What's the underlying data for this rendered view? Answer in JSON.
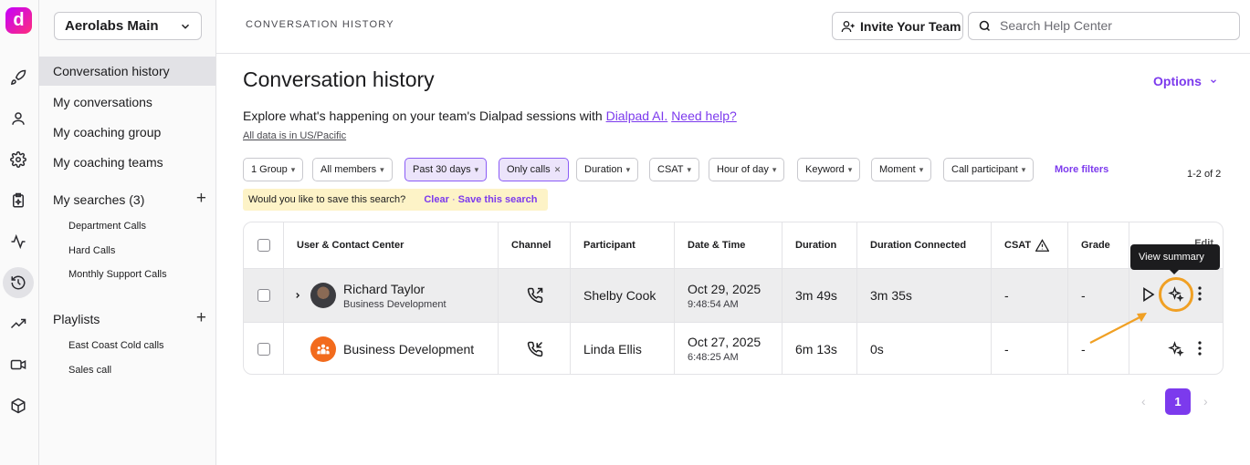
{
  "app": {
    "logo_letter": "d"
  },
  "sidebar": {
    "workspace": "Aerolabs Main",
    "nav": [
      {
        "label": "Conversation history"
      },
      {
        "label": "My conversations"
      },
      {
        "label": "My coaching group"
      },
      {
        "label": "My coaching teams"
      }
    ],
    "searches_label": "My searches (3)",
    "searches": [
      "Department Calls",
      "Hard Calls",
      "Monthly Support Calls"
    ],
    "playlists_label": "Playlists",
    "playlists": [
      "East Coast Cold calls",
      "Sales call"
    ]
  },
  "topbar": {
    "breadcrumb": "CONVERSATION HISTORY",
    "invite_label": "Invite Your Team",
    "search_placeholder": "Search Help Center"
  },
  "main": {
    "title": "Conversation history",
    "options_label": "Options",
    "explore_text": "Explore what's happening on your team's Dialpad sessions with ",
    "dialpad_ai_link": "Dialpad AI.",
    "need_help_link": "Need help?",
    "timezone_note": "All data is in US/Pacific",
    "filters": [
      {
        "label": "1 Group",
        "selected": false
      },
      {
        "label": "All members",
        "selected": false
      },
      {
        "label": "Past 30 days",
        "selected": true
      },
      {
        "label": "Only calls",
        "selected": true
      },
      {
        "label": "Duration",
        "selected": false
      },
      {
        "label": "CSAT",
        "selected": false
      },
      {
        "label": "Hour of day",
        "selected": false
      },
      {
        "label": "Keyword",
        "selected": false
      },
      {
        "label": "Moment",
        "selected": false
      },
      {
        "label": "Call participant",
        "selected": false
      }
    ],
    "more_filters": "More filters",
    "result_count": "1-2 of 2",
    "save_prompt": "Would you like to save this search?",
    "clear_label": "Clear",
    "separator": "·",
    "save_search_label": "Save this search"
  },
  "table": {
    "columns": [
      "User & Contact Center",
      "Channel",
      "Participant",
      "Date & Time",
      "Duration",
      "Duration Connected",
      "CSAT",
      "Grade"
    ],
    "edit_label": "Edit",
    "rows": [
      {
        "user": "Richard Taylor",
        "contact_center": "Business Development",
        "channel": "outbound-call",
        "participant": "Shelby Cook",
        "date": "Oct 29, 2025",
        "time": "9:48:54 AM",
        "duration": "3m 49s",
        "connected": "3m 35s",
        "csat": "-",
        "grade": "-"
      },
      {
        "user": "Business Development",
        "contact_center": "",
        "channel": "inbound-call",
        "participant": "Linda Ellis",
        "date": "Oct 27, 2025",
        "time": "6:48:25 AM",
        "duration": "6m 13s",
        "connected": "0s",
        "csat": "-",
        "grade": "-"
      }
    ]
  },
  "tooltip": "View summary",
  "pagination": {
    "current_page": "1"
  },
  "colors": {
    "accent": "#7c3aed",
    "highlight": "#f0a024",
    "save_bar": "#fdf3c7",
    "contact_center_avatar": "#f26b1d"
  }
}
